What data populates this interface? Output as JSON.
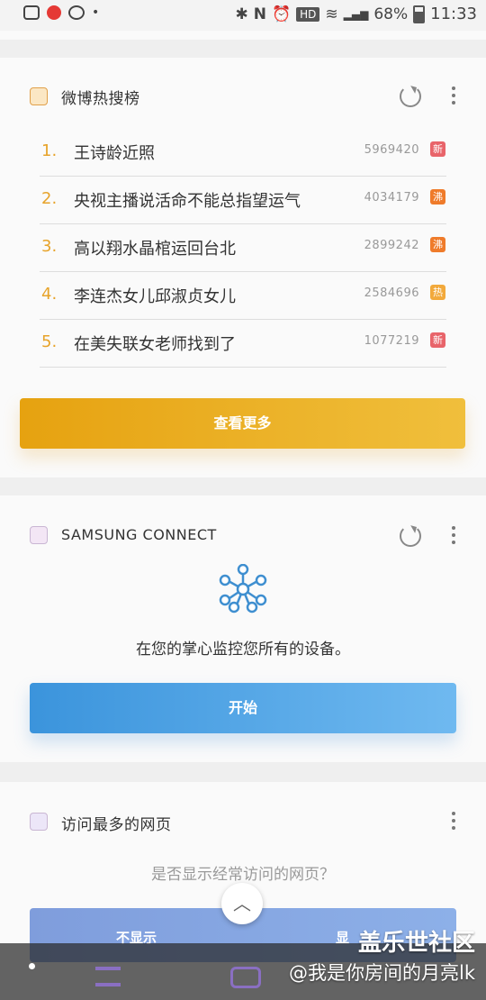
{
  "status_bar": {
    "hd": "HD",
    "battery_percent": "68%",
    "time": "11:33"
  },
  "weibo_card": {
    "title": "微博热搜榜",
    "items": [
      {
        "rank": "1.",
        "title": "王诗龄近照",
        "count": "5969420",
        "badge": "新",
        "badge_color": "#e8646a"
      },
      {
        "rank": "2.",
        "title": "央视主播说活命不能总指望运气",
        "count": "4034179",
        "badge": "沸",
        "badge_color": "#ef7b2a"
      },
      {
        "rank": "3.",
        "title": "高以翔水晶棺运回台北",
        "count": "2899242",
        "badge": "沸",
        "badge_color": "#ef7b2a"
      },
      {
        "rank": "4.",
        "title": "李连杰女儿邱淑贞女儿",
        "count": "2584696",
        "badge": "热",
        "badge_color": "#f2a93b"
      },
      {
        "rank": "5.",
        "title": "在美失联女老师找到了",
        "count": "1077219",
        "badge": "新",
        "badge_color": "#e8646a"
      }
    ],
    "more_button": "查看更多"
  },
  "samsung_card": {
    "title": "SAMSUNG CONNECT",
    "description": "在您的掌心监控您所有的设备。",
    "start_button": "开始"
  },
  "visited_card": {
    "title": "访问最多的网页",
    "question": "是否显示经常访问的网页？",
    "no_button": "不显示",
    "yes_button_partial": "显"
  },
  "watermark": {
    "site": "盖乐世社区",
    "user": "@我是你房间的月亮lk"
  },
  "colors": {
    "accent_orange": "#e6a210",
    "accent_blue": "#3b94dc",
    "rank_color": "#e7a32a"
  }
}
